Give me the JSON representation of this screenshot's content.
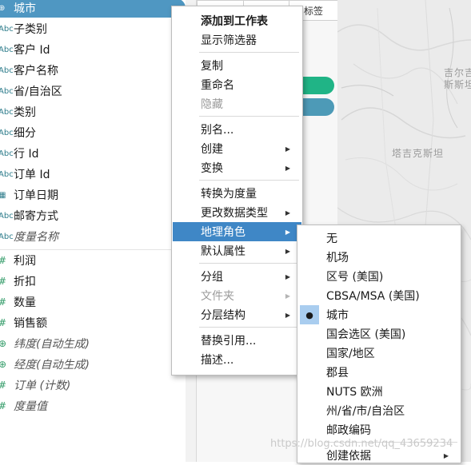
{
  "data_pane": {
    "selected_index": 0,
    "dimensions": [
      {
        "icon": "⊕",
        "label": "城市",
        "italic": false
      },
      {
        "icon": "Abc",
        "label": "子类别",
        "italic": false
      },
      {
        "icon": "Abc",
        "label": "客户 Id",
        "italic": false
      },
      {
        "icon": "Abc",
        "label": "客户名称",
        "italic": false
      },
      {
        "icon": "Abc",
        "label": "省/自治区",
        "italic": false
      },
      {
        "icon": "Abc",
        "label": "类别",
        "italic": false
      },
      {
        "icon": "Abc",
        "label": "细分",
        "italic": false
      },
      {
        "icon": "Abc",
        "label": "行 Id",
        "italic": false
      },
      {
        "icon": "Abc",
        "label": "订单 Id",
        "italic": false
      },
      {
        "icon": "▦",
        "label": "订单日期",
        "italic": false
      },
      {
        "icon": "Abc",
        "label": "邮寄方式",
        "italic": false
      },
      {
        "icon": "Abc",
        "label": "度量名称",
        "italic": true
      }
    ],
    "measures": [
      {
        "icon": "#",
        "label": "利润",
        "italic": false
      },
      {
        "icon": "#",
        "label": "折扣",
        "italic": false
      },
      {
        "icon": "#",
        "label": "数量",
        "italic": false
      },
      {
        "icon": "#",
        "label": "销售额",
        "italic": false
      },
      {
        "icon": "⊕",
        "label": "纬度(自动生成)",
        "italic": true
      },
      {
        "icon": "⊕",
        "label": "经度(自动生成)",
        "italic": true
      },
      {
        "icon": "#",
        "label": "订单 (计数)",
        "italic": true
      },
      {
        "icon": "#",
        "label": "度量值",
        "italic": true
      }
    ]
  },
  "marks_card": {
    "tile_label": "标签",
    "pill_colors": [
      "#20b486",
      "#4d9ab7"
    ]
  },
  "map": {
    "labels": [
      "吉尔吉",
      "斯斯坦",
      "塔吉克斯坦"
    ]
  },
  "context_menu": {
    "items": [
      {
        "label": "添加到工作表",
        "bold": true,
        "disabled": false,
        "arrow": false
      },
      {
        "label": "显示筛选器",
        "bold": false,
        "disabled": false,
        "arrow": false
      },
      {
        "sep": true
      },
      {
        "label": "复制",
        "bold": false,
        "disabled": false,
        "arrow": false
      },
      {
        "label": "重命名",
        "bold": false,
        "disabled": false,
        "arrow": false
      },
      {
        "label": "隐藏",
        "bold": false,
        "disabled": true,
        "arrow": false
      },
      {
        "sep": true
      },
      {
        "label": "别名...",
        "bold": false,
        "disabled": false,
        "arrow": false
      },
      {
        "label": "创建",
        "bold": false,
        "disabled": false,
        "arrow": true
      },
      {
        "label": "变换",
        "bold": false,
        "disabled": false,
        "arrow": true
      },
      {
        "sep": true
      },
      {
        "label": "转换为度量",
        "bold": false,
        "disabled": false,
        "arrow": false
      },
      {
        "label": "更改数据类型",
        "bold": false,
        "disabled": false,
        "arrow": true
      },
      {
        "label": "地理角色",
        "bold": false,
        "disabled": false,
        "arrow": true,
        "highlighted": true
      },
      {
        "label": "默认属性",
        "bold": false,
        "disabled": false,
        "arrow": true
      },
      {
        "sep": true
      },
      {
        "label": "分组",
        "bold": false,
        "disabled": false,
        "arrow": true
      },
      {
        "label": "文件夹",
        "bold": false,
        "disabled": true,
        "arrow": true
      },
      {
        "label": "分层结构",
        "bold": false,
        "disabled": false,
        "arrow": true
      },
      {
        "sep": true
      },
      {
        "label": "替换引用...",
        "bold": false,
        "disabled": false,
        "arrow": false
      },
      {
        "label": "描述...",
        "bold": false,
        "disabled": false,
        "arrow": false
      }
    ]
  },
  "geo_submenu": {
    "checked_index": 4,
    "items": [
      {
        "label": "无"
      },
      {
        "label": "机场"
      },
      {
        "label": "区号 (美国)"
      },
      {
        "label": "CBSA/MSA (美国)"
      },
      {
        "label": "城市"
      },
      {
        "label": "国会选区 (美国)"
      },
      {
        "label": "国家/地区"
      },
      {
        "label": "郡县"
      },
      {
        "label": "NUTS 欧洲"
      },
      {
        "label": "州/省/市/自治区"
      },
      {
        "label": "邮政编码"
      },
      {
        "sep": true
      },
      {
        "label": "创建依据",
        "arrow": true
      }
    ],
    "check_glyph": "●",
    "arrow_glyph": "▶"
  },
  "watermark": "https://blog.csdn.net/qq_43659234"
}
